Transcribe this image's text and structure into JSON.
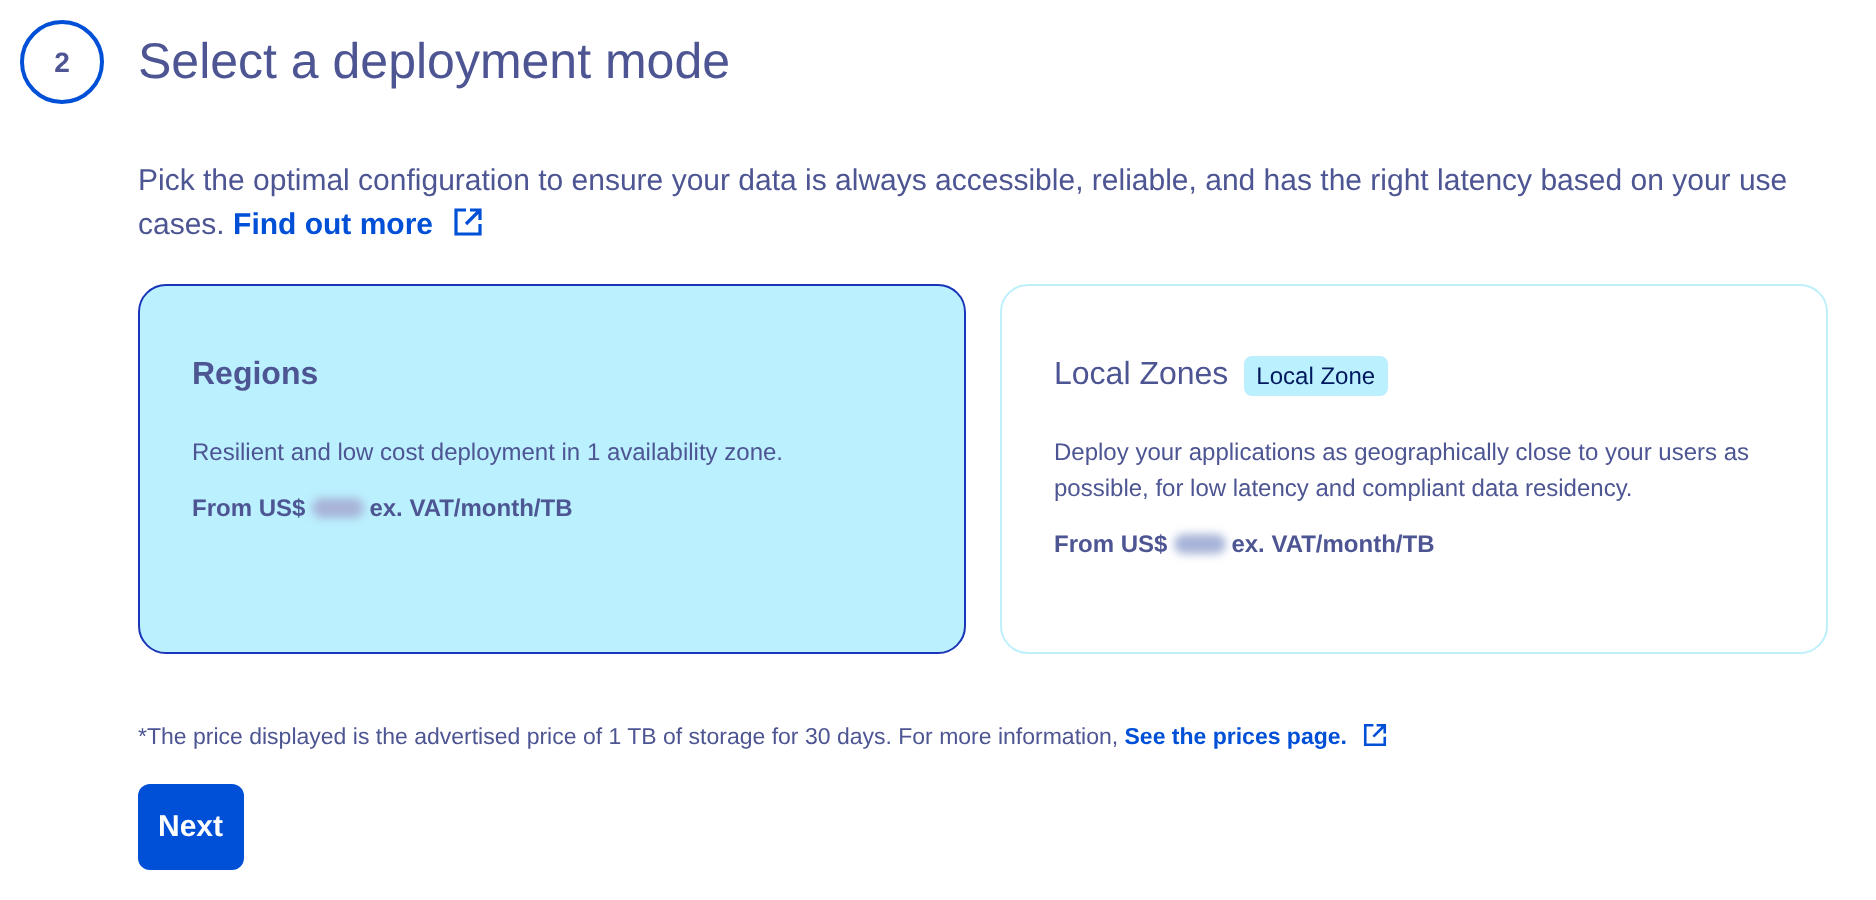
{
  "step": {
    "number": "2",
    "title": "Select a deployment mode"
  },
  "intro": {
    "text": "Pick the optimal configuration to ensure your data is always accessible, reliable, and has the right latency based on your use cases.",
    "link": "Find out more"
  },
  "options": [
    {
      "title": "Regions",
      "selected": true,
      "description": "Resilient and low cost deployment in 1 availability zone.",
      "price_prefix": "From US$",
      "price_suffix": "ex. VAT/month/TB"
    },
    {
      "title": "Local Zones",
      "badge": "Local Zone",
      "selected": false,
      "description": "Deploy your applications as geographically close to your users as possible, for low latency and compliant data residency.",
      "price_prefix": "From US$",
      "price_suffix": "ex. VAT/month/TB"
    }
  ],
  "footnote": {
    "text": "*The price displayed is the advertised price of 1 TB of storage for 30 days. For more information,",
    "link": "See the prices page."
  },
  "buttons": [
    "Next"
  ]
}
